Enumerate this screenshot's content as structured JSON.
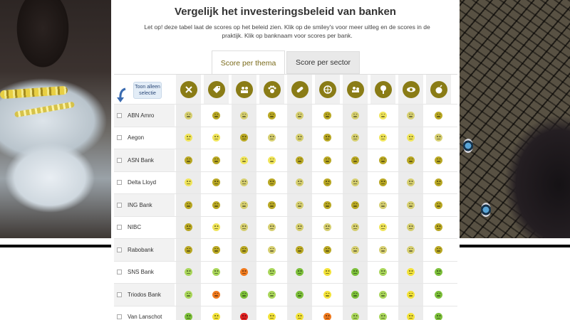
{
  "page": {
    "title": "Vergelijk het investeringsbeleid van banken",
    "description": "Let op! deze tabel laat de scores op het beleid zien. Klik op de smiley's voor meer uitleg en de scores in de praktijk. Klik op banknaam voor scores per bank."
  },
  "tabs": [
    {
      "label": "Score per thema",
      "active": true
    },
    {
      "label": "Score per sector",
      "active": false
    }
  ],
  "toggle": {
    "label": "Toon alleen selectie"
  },
  "theme_icons": [
    "tools-icon",
    "tag-icon",
    "people-icon",
    "paw-icon",
    "pill-icon",
    "globe-icon",
    "handshake-icon",
    "tree-icon",
    "eye-icon",
    "bomb-icon"
  ],
  "colors": {
    "olive": "#b9a824",
    "olive_dark": "#8a7c16",
    "yellow_light": "#f0e55a",
    "khaki": "#d6cf70",
    "green": "#7cbf3a",
    "green_light": "#a9d65a",
    "orange": "#f07a1e",
    "red": "#e02020",
    "yellow": "#f3e33a"
  },
  "banks": [
    {
      "name": "ABN Amro",
      "scores": [
        "khaki",
        "olive",
        "khaki",
        "olive_h",
        "khaki",
        "olive_h",
        "khaki",
        "yellow_light",
        "khaki",
        "olive"
      ]
    },
    {
      "name": "Aegon",
      "scores": [
        "yellow_light",
        "yellow_light",
        "olive_h",
        "khaki",
        "khaki",
        "olive_h",
        "khaki",
        "yellow_light",
        "yellow_light",
        "khaki"
      ]
    },
    {
      "name": "ASN Bank",
      "scores": [
        "olive",
        "olive",
        "yellow_light",
        "yellow_light",
        "olive",
        "olive",
        "olive",
        "olive",
        "olive",
        "olive"
      ]
    },
    {
      "name": "Delta Lloyd",
      "scores": [
        "yellow_light",
        "olive_h",
        "khaki",
        "olive_h",
        "khaki",
        "olive_h",
        "khaki",
        "olive_h",
        "khaki",
        "olive"
      ]
    },
    {
      "name": "ING Bank",
      "scores": [
        "olive",
        "olive",
        "khaki",
        "olive_h",
        "khaki",
        "olive_h",
        "olive",
        "khaki",
        "khaki",
        "olive"
      ]
    },
    {
      "name": "NIBC",
      "scores": [
        "olive",
        "yellow_light",
        "khaki",
        "khaki",
        "khaki",
        "khaki",
        "khaki",
        "yellow_light",
        "khaki",
        "olive"
      ]
    },
    {
      "name": "Rabobank",
      "scores": [
        "olive",
        "olive_h",
        "olive_h",
        "khaki",
        "olive_h",
        "olive",
        "khaki",
        "khaki",
        "khaki",
        "olive"
      ]
    },
    {
      "name": "SNS Bank",
      "scores": [
        "green_light",
        "green_light",
        "orange",
        "green_light",
        "green",
        "yellow",
        "green",
        "green_light",
        "yellow",
        "green"
      ]
    },
    {
      "name": "Triodos Bank",
      "scores": [
        "green_light",
        "orange",
        "green",
        "green_light",
        "green",
        "yellow",
        "green",
        "green_light",
        "yellow",
        "green"
      ]
    },
    {
      "name": "Van Lanschot",
      "scores": [
        "green",
        "yellow",
        "red",
        "yellow",
        "yellow",
        "orange",
        "green_light",
        "green_light",
        "yellow",
        "green"
      ]
    }
  ]
}
